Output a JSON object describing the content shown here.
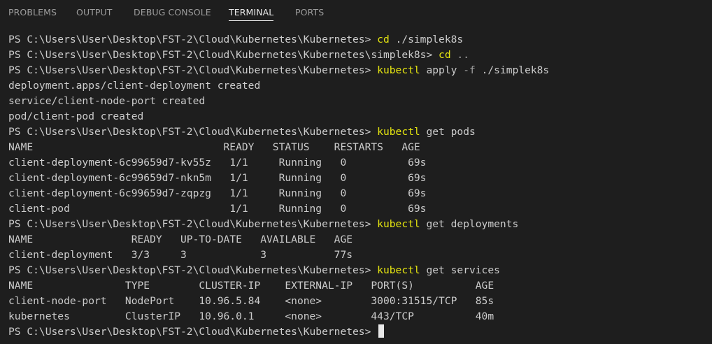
{
  "tabs": [
    {
      "label": "PROBLEMS",
      "active": false
    },
    {
      "label": "OUTPUT",
      "active": false
    },
    {
      "label": "DEBUG CONSOLE",
      "active": false
    },
    {
      "label": "TERMINAL",
      "active": true
    },
    {
      "label": "PORTS",
      "active": false
    }
  ],
  "colors": {
    "background": "#1e1e1e",
    "text": "#cccccc",
    "command": "#e5e510",
    "flag": "#a0a0a0",
    "tab_inactive": "#9d9d9d",
    "tab_active": "#e7e7e7"
  },
  "terminal": {
    "lines": [
      [
        {
          "t": "PS C:\\Users\\User\\Desktop\\FST-2\\Cloud\\Kubernetes\\Kubernetes> "
        },
        {
          "t": "cd",
          "c": "cmd"
        },
        {
          "t": " ./simplek8s"
        }
      ],
      [
        {
          "t": "PS C:\\Users\\User\\Desktop\\FST-2\\Cloud\\Kubernetes\\Kubernetes\\simplek8s> "
        },
        {
          "t": "cd",
          "c": "cmd"
        },
        {
          "t": " ..",
          "c": "flag"
        }
      ],
      [
        {
          "t": "PS C:\\Users\\User\\Desktop\\FST-2\\Cloud\\Kubernetes\\Kubernetes> "
        },
        {
          "t": "kubectl",
          "c": "cmd"
        },
        {
          "t": " apply "
        },
        {
          "t": "-f",
          "c": "flag"
        },
        {
          "t": " ./simplek8s"
        }
      ],
      [
        {
          "t": "deployment.apps/client-deployment created"
        }
      ],
      [
        {
          "t": "service/client-node-port created"
        }
      ],
      [
        {
          "t": "pod/client-pod created"
        }
      ],
      [
        {
          "t": "PS C:\\Users\\User\\Desktop\\FST-2\\Cloud\\Kubernetes\\Kubernetes> "
        },
        {
          "t": "kubectl",
          "c": "cmd"
        },
        {
          "t": " get pods"
        }
      ],
      [
        {
          "t": "NAME                               READY   STATUS    RESTARTS   AGE"
        }
      ],
      [
        {
          "t": "client-deployment-6c99659d7-kv55z   1/1     Running   0          69s"
        }
      ],
      [
        {
          "t": "client-deployment-6c99659d7-nkn5m   1/1     Running   0          69s"
        }
      ],
      [
        {
          "t": "client-deployment-6c99659d7-zqpzg   1/1     Running   0          69s"
        }
      ],
      [
        {
          "t": "client-pod                          1/1     Running   0          69s"
        }
      ],
      [
        {
          "t": "PS C:\\Users\\User\\Desktop\\FST-2\\Cloud\\Kubernetes\\Kubernetes> "
        },
        {
          "t": "kubectl",
          "c": "cmd"
        },
        {
          "t": " get deployments"
        }
      ],
      [
        {
          "t": "NAME                READY   UP-TO-DATE   AVAILABLE   AGE"
        }
      ],
      [
        {
          "t": "client-deployment   3/3     3            3           77s"
        }
      ],
      [
        {
          "t": "PS C:\\Users\\User\\Desktop\\FST-2\\Cloud\\Kubernetes\\Kubernetes> "
        },
        {
          "t": "kubectl",
          "c": "cmd"
        },
        {
          "t": " get services"
        }
      ],
      [
        {
          "t": "NAME               TYPE        CLUSTER-IP    EXTERNAL-IP   PORT(S)          AGE"
        }
      ],
      [
        {
          "t": "client-node-port   NodePort    10.96.5.84    <none>        3000:31515/TCP   85s"
        }
      ],
      [
        {
          "t": "kubernetes         ClusterIP   10.96.0.1     <none>        443/TCP          40m"
        }
      ],
      [
        {
          "t": "PS C:\\Users\\User\\Desktop\\FST-2\\Cloud\\Kubernetes\\Kubernetes> "
        }
      ]
    ]
  }
}
